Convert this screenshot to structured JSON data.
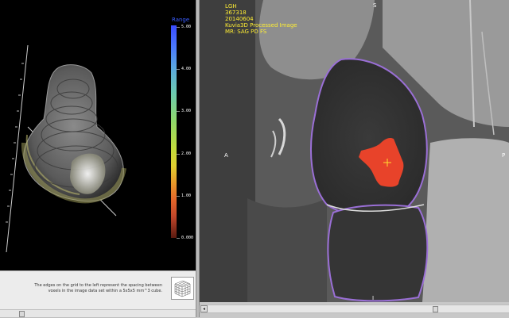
{
  "legend": {
    "title": "Range",
    "ticks": [
      "5.00",
      "4.00",
      "3.00",
      "2.00",
      "1.00",
      "0.000"
    ],
    "tick_levels": [
      5,
      4,
      3,
      2,
      1,
      0
    ],
    "range": [
      0,
      5
    ]
  },
  "info_panel": {
    "text": "The edges on the grid to the left represent the spacing between voxels in the image data set within a 5x5x5 mm^3 cube."
  },
  "mr_overlay": {
    "line1": "LGH",
    "line2": "367318",
    "line3": "20140604",
    "line4": "Kuvia3D Processed Image",
    "line5": "MR: SAG PD FS"
  },
  "orientation": {
    "top": "S",
    "left": "A",
    "right": "P",
    "bottom": "I"
  },
  "scrollbars": {
    "left_position": 0.1,
    "right_position": 0.77
  },
  "icons": {
    "scroll_left": "◂"
  },
  "colors": {
    "lesion": "#e8432a",
    "contour": "#9a6fd6",
    "overlay_text": "#ffee33",
    "legend_title": "#3a5dff"
  }
}
